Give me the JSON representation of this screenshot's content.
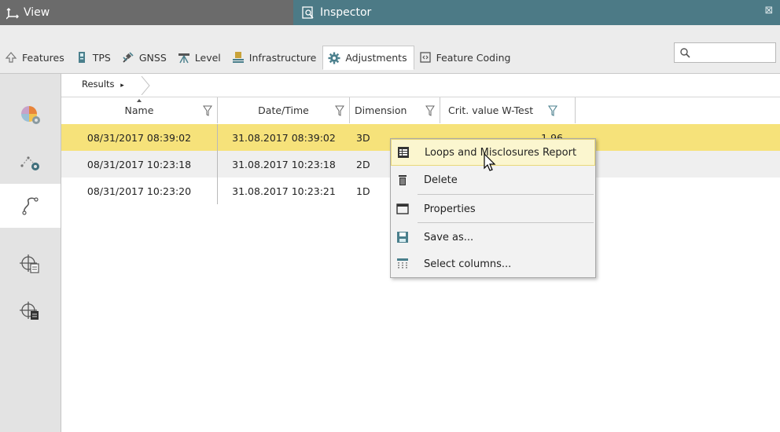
{
  "titlebar": {
    "view_label": "View",
    "inspector_label": "Inspector",
    "close_glyph": "⊠"
  },
  "tabs": [
    {
      "label": "Features",
      "icon": "features-icon"
    },
    {
      "label": "TPS",
      "icon": "tps-icon"
    },
    {
      "label": "GNSS",
      "icon": "gnss-icon"
    },
    {
      "label": "Level",
      "icon": "level-icon"
    },
    {
      "label": "Infrastructure",
      "icon": "infrastructure-icon"
    },
    {
      "label": "Adjustments",
      "icon": "adjustments-gear-icon",
      "active": true
    },
    {
      "label": "Feature Coding",
      "icon": "feature-coding-icon"
    }
  ],
  "search": {
    "value": "",
    "placeholder": ""
  },
  "breadcrumb": {
    "label": "Results",
    "arrow": "▸"
  },
  "rail": [
    {
      "icon": "adjustment-pie-icon"
    },
    {
      "icon": "network-settings-icon"
    },
    {
      "icon": "loops-icon",
      "active": true
    },
    {
      "icon": "station-results-icon"
    },
    {
      "icon": "station-report-icon"
    }
  ],
  "grid": {
    "columns": [
      "Name",
      "Date/Time",
      "Dimension",
      "Crit. value W-Test"
    ],
    "rows": [
      {
        "name": "08/31/2017 08:39:02",
        "datetime": "31.08.2017 08:39:02",
        "dimension": "3D",
        "crit": "1.96",
        "selected": true
      },
      {
        "name": "08/31/2017 10:23:18",
        "datetime": "31.08.2017 10:23:18",
        "dimension": "2D",
        "crit": ""
      },
      {
        "name": "08/31/2017 10:23:20",
        "datetime": "31.08.2017 10:23:21",
        "dimension": "1D",
        "crit": ""
      }
    ]
  },
  "context_menu": {
    "items": [
      {
        "label": "Loops and Misclosures Report",
        "icon": "report-icon"
      },
      {
        "label": "Delete",
        "icon": "trash-icon"
      },
      {
        "label": "Properties",
        "icon": "properties-icon"
      },
      {
        "label": "Save as...",
        "icon": "save-icon"
      },
      {
        "label": "Select columns...",
        "icon": "columns-icon"
      }
    ]
  },
  "colors": {
    "view_bar": "#6b6b6b",
    "inspector_bar": "#4c7a86",
    "selected_row": "#f6e27a",
    "accent_gear": "#4a7f8c"
  }
}
